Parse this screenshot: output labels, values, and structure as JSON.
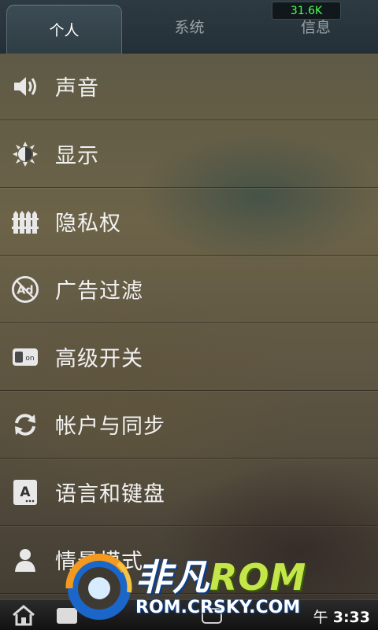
{
  "tabs": [
    {
      "label": "个人",
      "active": true
    },
    {
      "label": "系统",
      "active": false
    },
    {
      "label": "信息",
      "active": false
    }
  ],
  "speed": "31.6K",
  "menu": [
    {
      "label": "声音",
      "icon": "speaker-icon"
    },
    {
      "label": "显示",
      "icon": "brightness-icon"
    },
    {
      "label": "隐私权",
      "icon": "fence-icon"
    },
    {
      "label": "广告过滤",
      "icon": "ad-block-icon"
    },
    {
      "label": "高级开关",
      "icon": "toggle-on-icon"
    },
    {
      "label": "帐户与同步",
      "icon": "sync-icon"
    },
    {
      "label": "语言和键盘",
      "icon": "keyboard-letter-icon"
    },
    {
      "label": "情景模式",
      "icon": "profile-person-icon"
    }
  ],
  "status": {
    "time_prefix": "午",
    "time": "3:33"
  },
  "watermark": {
    "brand_cn": "非凡",
    "brand_rom": "ROM",
    "url": "ROM.CRSKY.COM"
  }
}
